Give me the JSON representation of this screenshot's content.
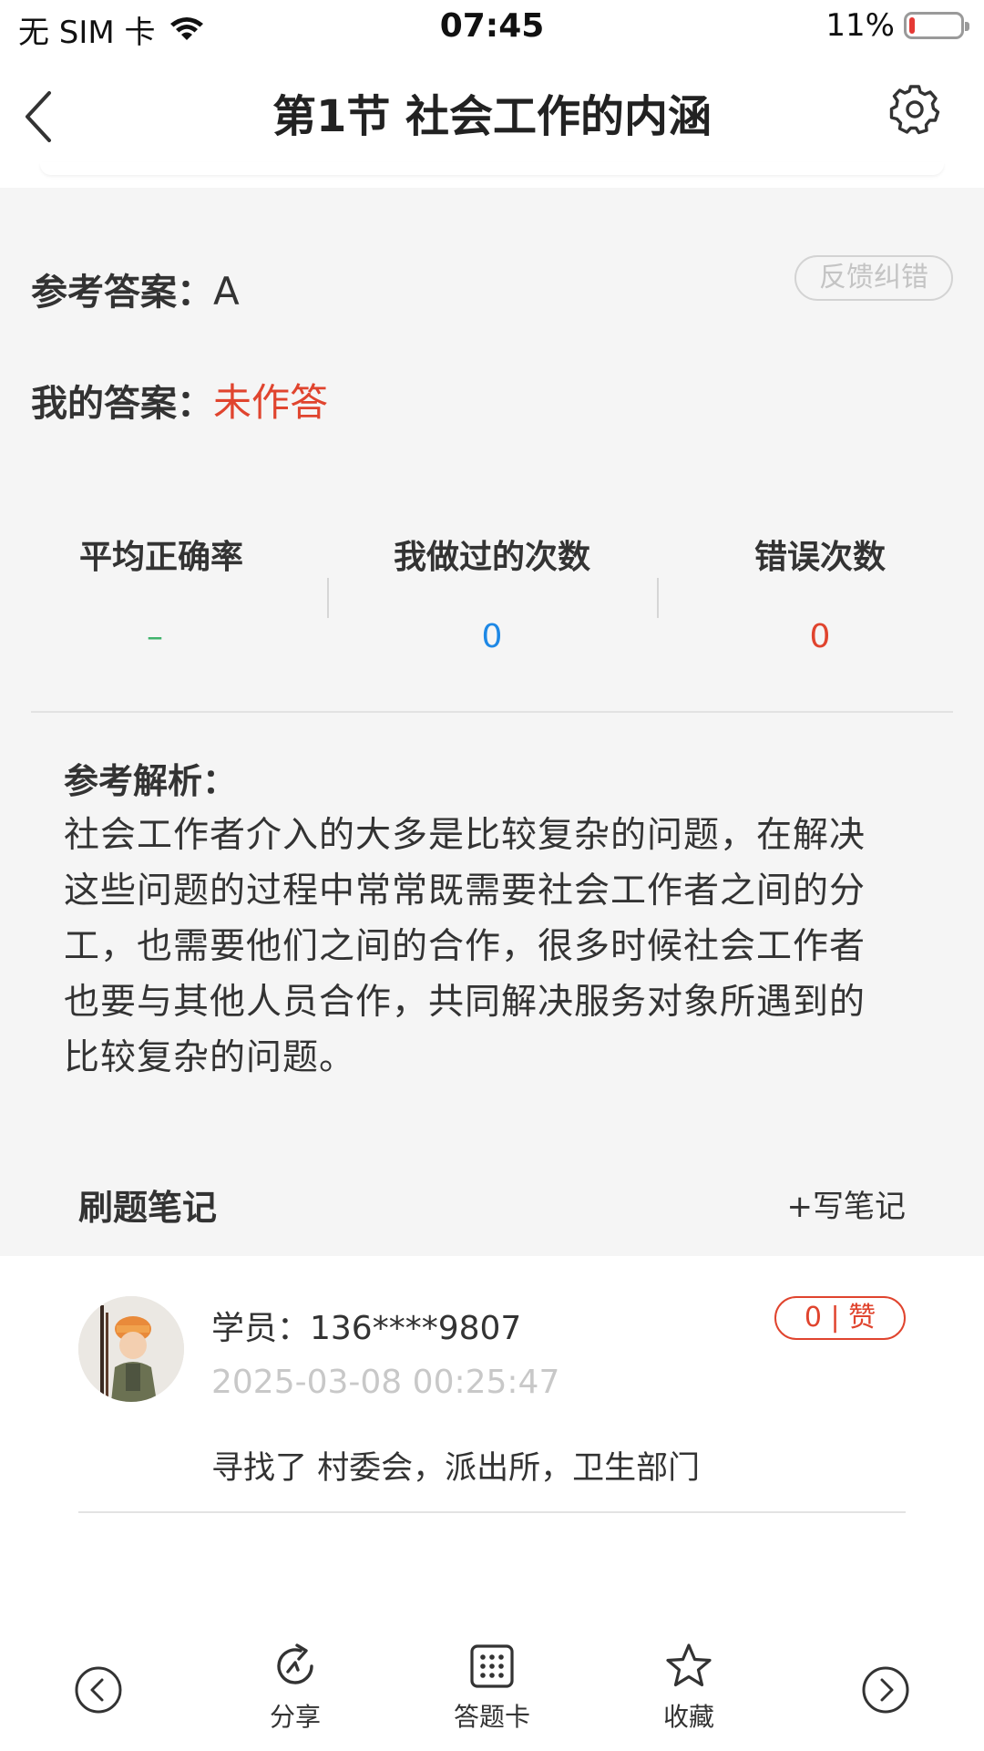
{
  "status_bar": {
    "carrier": "无 SIM 卡",
    "time": "07:45",
    "battery": "11%",
    "battery_level": 0.11,
    "battery_color": "#e53935"
  },
  "nav": {
    "title": "第1节 社会工作的内涵",
    "back_icon": "chevron-left-icon",
    "settings_icon": "gear-icon"
  },
  "answer": {
    "ref_label": "参考答案：",
    "ref_value": "A",
    "feedback_label": "反馈纠错",
    "my_label": "我的答案：",
    "my_value": "未作答",
    "my_value_color": "#e0442e"
  },
  "stats": [
    {
      "label": "平均正确率",
      "value": "–",
      "color": "#3fb36b"
    },
    {
      "label": "我做过的次数",
      "value": "0",
      "color": "#1e88e5"
    },
    {
      "label": "错误次数",
      "value": "0",
      "color": "#e0442e"
    }
  ],
  "analysis": {
    "title": "参考解析：",
    "text": "社会工作者介入的大多是比较复杂的问题，在解决这些问题的过程中常常既需要社会工作者之间的分工，也需要他们之间的合作，很多时候社会工作者也要与其他人员合作，共同解决服务对象所遇到的比较复杂的问题。"
  },
  "notes": {
    "title": "刷题笔记",
    "write_label": "+写笔记",
    "items": [
      {
        "user": "学员：136****9807",
        "time": "2025-03-08 00:25:47",
        "likes": "0 | 赞",
        "content": "寻找了 村委会，派出所，卫生部门"
      }
    ]
  },
  "bottom_bar": {
    "prev_icon": "circle-chevron-left-icon",
    "share_label": "分享",
    "card_label": "答题卡",
    "favorite_label": "收藏",
    "next_icon": "circle-chevron-right-icon"
  }
}
